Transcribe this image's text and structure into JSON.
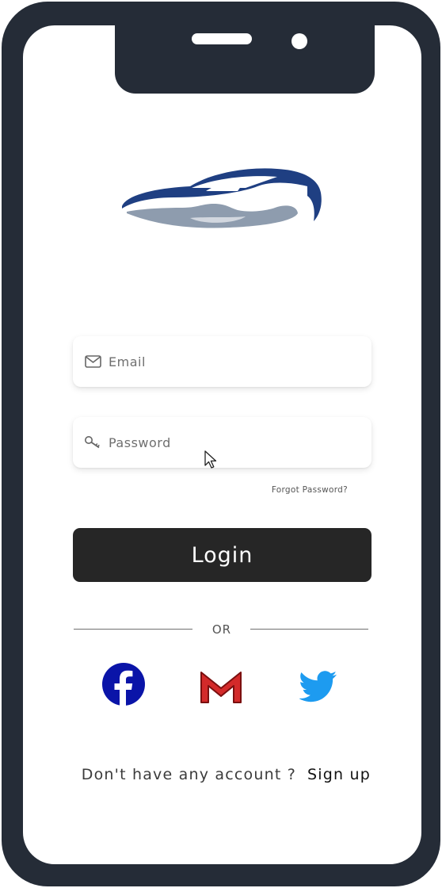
{
  "login_form": {
    "email_placeholder": "Email",
    "password_placeholder": "Password",
    "forgot_password": "Forgot Password?",
    "login_label": "Login",
    "divider_text": "OR"
  },
  "social_login": [
    {
      "name": "facebook",
      "icon": "facebook-icon",
      "color": "#0a14a8"
    },
    {
      "name": "gmail",
      "icon": "gmail-icon",
      "color": "#d32a2a"
    },
    {
      "name": "twitter",
      "icon": "twitter-icon",
      "color": "#1d9bf0"
    }
  ],
  "signup": {
    "prompt": "Don't have any account ?",
    "link": "Sign up"
  },
  "colors": {
    "frame": "#252c37",
    "button": "#262626",
    "logo_primary": "#1f3f82",
    "logo_secondary": "#8e9cae"
  }
}
